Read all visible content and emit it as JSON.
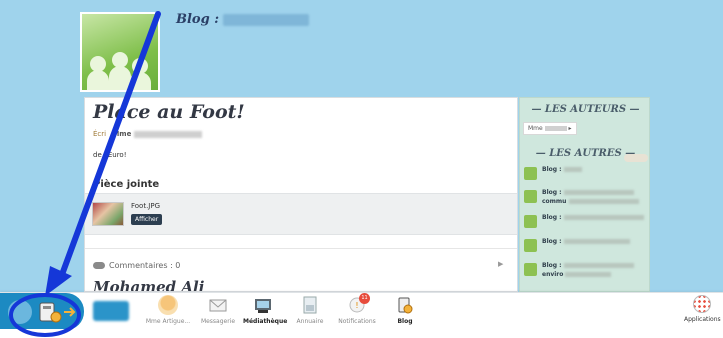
{
  "blog": {
    "title": "Blog :",
    "name_redacted": true
  },
  "post": {
    "title": "Place au Foot!",
    "meta_category": "Écri",
    "meta_author": "Mme",
    "body": "de l'Euro!",
    "attachment_heading": "Pièce jointe",
    "attachment_file": "Foot.JPG",
    "attachment_button": "Afficher",
    "comments_label": "Commentaires : 0",
    "next_post_title": "Mohamed Ali"
  },
  "sidebar": {
    "authors_heading": "— LES AUTEURS —",
    "author_chip": "Mme",
    "others_heading": "— LES AUTRES —",
    "blogs": [
      {
        "label": "Blog :",
        "second_line": ""
      },
      {
        "label": "Blog :",
        "second_line": "commu"
      },
      {
        "label": "Blog :",
        "second_line": ""
      },
      {
        "label": "Blog :",
        "second_line": ""
      },
      {
        "label": "Blog :",
        "second_line": "enviro"
      }
    ]
  },
  "toolbar": {
    "items": [
      {
        "label": "Mme Artigue...",
        "icon": "user-avatar-icon"
      },
      {
        "label": "Messagerie",
        "icon": "envelope-icon"
      },
      {
        "label": "Médiathèque",
        "icon": "media-library-icon"
      },
      {
        "label": "Annuaire",
        "icon": "directory-icon"
      },
      {
        "label": "Notifications",
        "icon": "bell-icon",
        "badge": "11"
      },
      {
        "label": "Blog",
        "icon": "blog-icon"
      }
    ],
    "apps_label": "Applications"
  },
  "colors": {
    "background": "#9fd3ec",
    "toolbar_accent": "#1c8ac2",
    "annotation": "#1537d8"
  }
}
